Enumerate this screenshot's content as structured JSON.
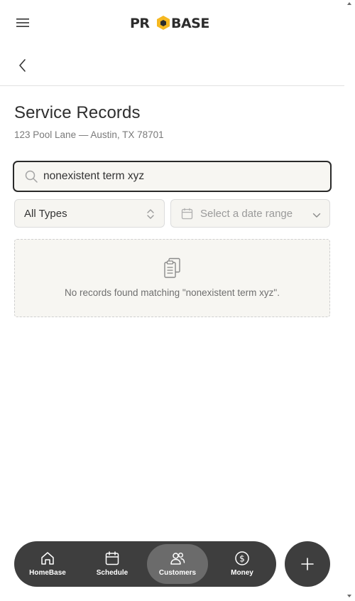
{
  "brand": {
    "logo_text": "PROBASE"
  },
  "page": {
    "title": "Service Records",
    "address": "123 Pool Lane — Austin, TX 78701"
  },
  "search": {
    "value": "nonexistent term xyz"
  },
  "filters": {
    "type_selected": "All Types",
    "date_placeholder": "Select a date range"
  },
  "empty_state": {
    "message": "No records found matching \"nonexistent term xyz\"."
  },
  "bottom_nav": {
    "items": [
      {
        "label": "HomeBase",
        "icon": "home-icon"
      },
      {
        "label": "Schedule",
        "icon": "calendar-icon"
      },
      {
        "label": "Customers",
        "icon": "users-icon",
        "active": true
      },
      {
        "label": "Money",
        "icon": "dollar-icon"
      }
    ]
  },
  "fab": {
    "icon": "plus-icon"
  },
  "colors": {
    "nav_bg": "#3e3e3e",
    "nav_active": "#6b6b6b",
    "logo_accent": "#f5b821",
    "field_bg": "#f6f5f1"
  }
}
